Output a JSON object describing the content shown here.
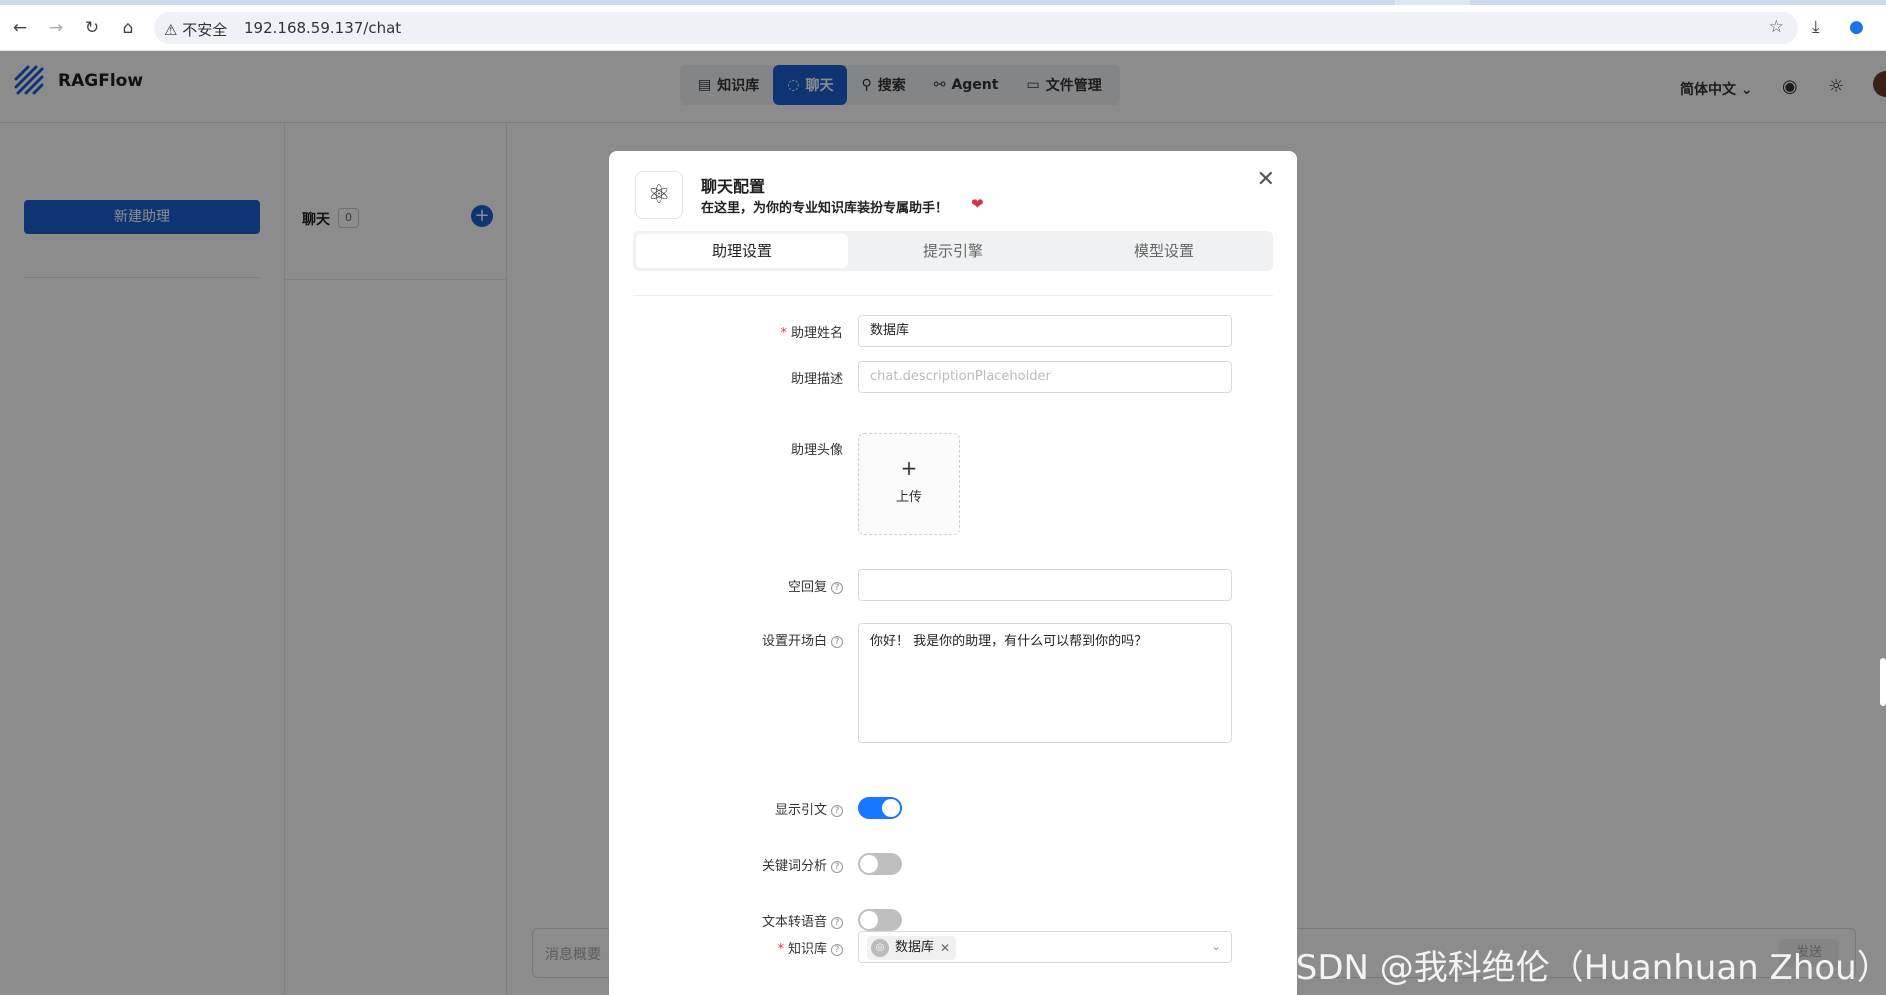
{
  "browser": {
    "security_label": "不安全",
    "url": "192.168.59.137/chat"
  },
  "header": {
    "brand": "RAGFlow",
    "nav": [
      {
        "label": "知识库",
        "icon": "database-icon"
      },
      {
        "label": "聊天",
        "icon": "chat-icon",
        "active": true
      },
      {
        "label": "搜索",
        "icon": "search-icon"
      },
      {
        "label": "Agent",
        "icon": "graph-icon"
      },
      {
        "label": "文件管理",
        "icon": "folder-icon"
      }
    ],
    "language": "简体中文"
  },
  "sidebar": {
    "new_assistant_label": "新建助理"
  },
  "chat_list": {
    "title": "聊天",
    "count": "0"
  },
  "message_input": {
    "placeholder": "消息概要",
    "send_label": "发送"
  },
  "modal": {
    "title": "聊天配置",
    "subtitle": "在这里，为你的专业知识库装扮专属助手！",
    "tabs": [
      "助理设置",
      "提示引擎",
      "模型设置"
    ],
    "active_tab": "助理设置",
    "fields": {
      "name_label": "助理姓名",
      "name_value": "数据库",
      "description_label": "助理描述",
      "description_placeholder": "chat.descriptionPlaceholder",
      "avatar_label": "助理头像",
      "upload_label": "上传",
      "empty_reply_label": "空回复",
      "empty_reply_value": "",
      "opener_label": "设置开场白",
      "opener_value": "你好！ 我是你的助理，有什么可以帮到你的吗？",
      "show_quote_label": "显示引文",
      "show_quote_on": true,
      "keyword_label": "关键词分析",
      "keyword_on": false,
      "tts_label": "文本转语音",
      "tts_on": false,
      "kb_label": "知识库",
      "kb_selected": "数据库"
    }
  },
  "watermark": "CSDN @我科绝伦（Huanhuan Zhou）",
  "colors": {
    "primary": "#1b5fd1",
    "switch_on": "#1677ff",
    "required": "#e03c3c"
  }
}
